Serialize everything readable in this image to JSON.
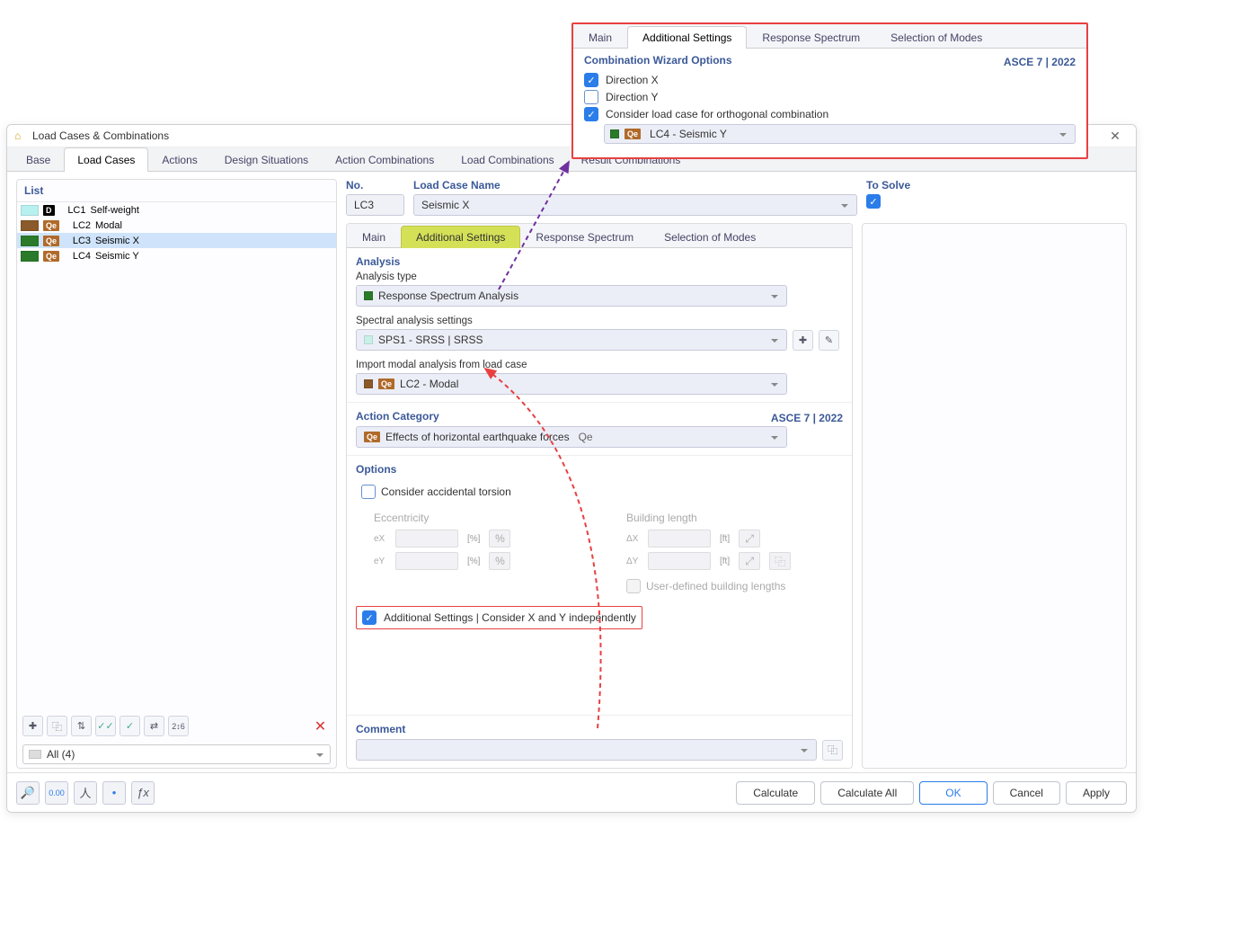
{
  "window": {
    "title": "Load Cases & Combinations"
  },
  "tabs": {
    "main": [
      "Base",
      "Load Cases",
      "Actions",
      "Design Situations",
      "Action Combinations",
      "Load Combinations",
      "Result Combinations"
    ],
    "activeIndex": 1
  },
  "list": {
    "header": "List",
    "items": [
      {
        "swatch": "#b8f0f0",
        "badgeType": "D",
        "id": "LC1",
        "name": "Self-weight"
      },
      {
        "swatch": "#8a5a2a",
        "badgeType": "Qe",
        "id": "LC2",
        "name": "Modal"
      },
      {
        "swatch": "#2a7a2a",
        "badgeType": "Qe",
        "id": "LC3",
        "name": "Seismic X",
        "selected": true
      },
      {
        "swatch": "#2a7a2a",
        "badgeType": "Qe",
        "id": "LC4",
        "name": "Seismic Y"
      }
    ],
    "filter": "All (4)"
  },
  "detail": {
    "noLabel": "No.",
    "noValue": "LC3",
    "nameLabel": "Load Case Name",
    "nameValue": "Seismic X",
    "toSolveLabel": "To Solve",
    "innerTabs": [
      "Main",
      "Additional Settings",
      "Response Spectrum",
      "Selection of Modes"
    ],
    "analysisHdr": "Analysis",
    "analysisTypeLbl": "Analysis type",
    "analysisType": "Response Spectrum Analysis",
    "spectralLbl": "Spectral analysis settings",
    "spectralValue": "SPS1 - SRSS | SRSS",
    "importLbl": "Import modal analysis from load case",
    "importValue": "LC2 - Modal",
    "actionCatHdr": "Action Category",
    "standard": "ASCE 7 | 2022",
    "actionCatValue": "Effects of horizontal earthquake forces",
    "actionCatSuffix": "Qe",
    "optionsHdr": "Options",
    "torsionLbl": "Consider accidental torsion",
    "eccHdr": "Eccentricity",
    "bldHdr": "Building length",
    "ex": "eX",
    "ey": "eY",
    "dx": "ΔX",
    "dy": "ΔY",
    "pctUnit": "[%]",
    "ftUnit": "[ft]",
    "userDefLbl": "User-defined building lengths",
    "addSettingsLbl": "Additional Settings | Consider X and Y independently",
    "commentHdr": "Comment"
  },
  "popout": {
    "tabs": [
      "Main",
      "Additional Settings",
      "Response Spectrum",
      "Selection of Modes"
    ],
    "hdr": "Combination Wizard Options",
    "standard": "ASCE 7 | 2022",
    "dirX": "Direction X",
    "dirY": "Direction Y",
    "considerLbl": "Consider load case for orthogonal combination",
    "lc4": "LC4 - Seismic Y"
  },
  "footer": {
    "calculate": "Calculate",
    "calculateAll": "Calculate All",
    "ok": "OK",
    "cancel": "Cancel",
    "apply": "Apply"
  }
}
